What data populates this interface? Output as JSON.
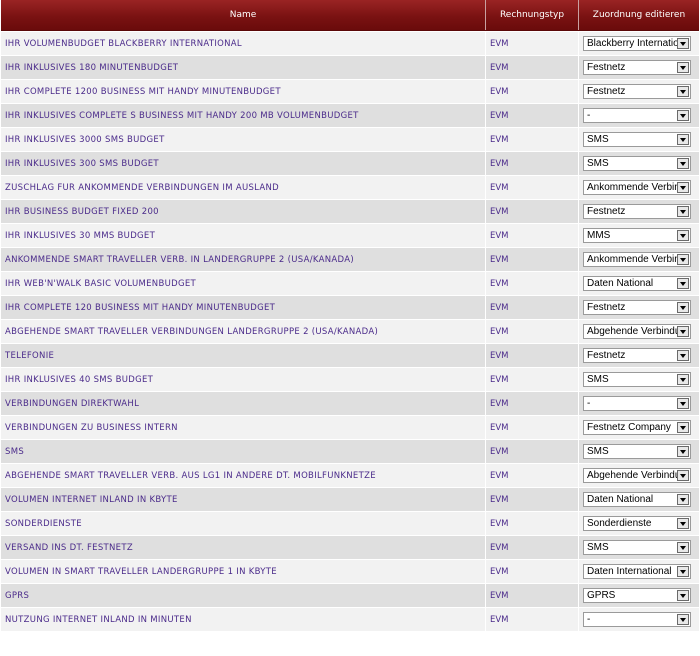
{
  "header": {
    "col_name": "Name",
    "col_type": "Rechnungstyp",
    "col_assign": "Zuordnung editieren"
  },
  "rows": [
    {
      "name": "IHR VOLUMENBUDGET BLACKBERRY INTERNATIONAL",
      "type": "EVM",
      "assign": "Blackberry International"
    },
    {
      "name": "IHR INKLUSIVES 180 MINUTENBUDGET",
      "type": "EVM",
      "assign": "Festnetz"
    },
    {
      "name": "IHR COMPLETE 1200 BUSINESS MIT HANDY MINUTENBUDGET",
      "type": "EVM",
      "assign": "Festnetz"
    },
    {
      "name": "IHR INKLUSIVES COMPLETE S BUSINESS MIT HANDY 200 MB VOLUMENBUDGET",
      "type": "EVM",
      "assign": "-"
    },
    {
      "name": "IHR INKLUSIVES 3000 SMS BUDGET",
      "type": "EVM",
      "assign": "SMS"
    },
    {
      "name": "IHR INKLUSIVES 300 SMS BUDGET",
      "type": "EVM",
      "assign": "SMS"
    },
    {
      "name": "ZUSCHLAG FUR ANKOMMENDE VERBINDUNGEN IM AUSLAND",
      "type": "EVM",
      "assign": "Ankommende Verbindungen"
    },
    {
      "name": "IHR BUSINESS BUDGET FIXED 200",
      "type": "EVM",
      "assign": "Festnetz"
    },
    {
      "name": "IHR INKLUSIVES 30 MMS BUDGET",
      "type": "EVM",
      "assign": "MMS"
    },
    {
      "name": "ANKOMMENDE SMART TRAVELLER VERB. IN LANDERGRUPPE 2 (USA/KANADA)",
      "type": "EVM",
      "assign": "Ankommende Verbindungen"
    },
    {
      "name": "IHR WEB'N'WALK BASIC VOLUMENBUDGET",
      "type": "EVM",
      "assign": "Daten National"
    },
    {
      "name": "IHR COMPLETE 120 BUSINESS MIT HANDY MINUTENBUDGET",
      "type": "EVM",
      "assign": "Festnetz"
    },
    {
      "name": "ABGEHENDE SMART TRAVELLER VERBINDUNGEN LANDERGRUPPE 2 (USA/KANADA)",
      "type": "EVM",
      "assign": "Abgehende Verbindungen"
    },
    {
      "name": "TELEFONIE",
      "type": "EVM",
      "assign": "Festnetz"
    },
    {
      "name": "IHR INKLUSIVES 40 SMS BUDGET",
      "type": "EVM",
      "assign": "SMS"
    },
    {
      "name": "VERBINDUNGEN DIREKTWAHL",
      "type": "EVM",
      "assign": "-"
    },
    {
      "name": "VERBINDUNGEN ZU BUSINESS INTERN",
      "type": "EVM",
      "assign": "Festnetz Company"
    },
    {
      "name": "SMS",
      "type": "EVM",
      "assign": "SMS"
    },
    {
      "name": "ABGEHENDE SMART TRAVELLER VERB. AUS LG1 IN ANDERE DT. MOBILFUNKNETZE",
      "type": "EVM",
      "assign": "Abgehende Verbindungen"
    },
    {
      "name": "VOLUMEN INTERNET INLAND IN KBYTE",
      "type": "EVM",
      "assign": "Daten National"
    },
    {
      "name": "SONDERDIENSTE",
      "type": "EVM",
      "assign": "Sonderdienste"
    },
    {
      "name": "VERSAND INS DT. FESTNETZ",
      "type": "EVM",
      "assign": "SMS"
    },
    {
      "name": "VOLUMEN IN SMART TRAVELLER LANDERGRUPPE 1 IN KBYTE",
      "type": "EVM",
      "assign": "Daten International"
    },
    {
      "name": "GPRS",
      "type": "EVM",
      "assign": "GPRS"
    },
    {
      "name": "NUTZUNG INTERNET INLAND IN MINUTEN",
      "type": "EVM",
      "assign": "-"
    }
  ]
}
